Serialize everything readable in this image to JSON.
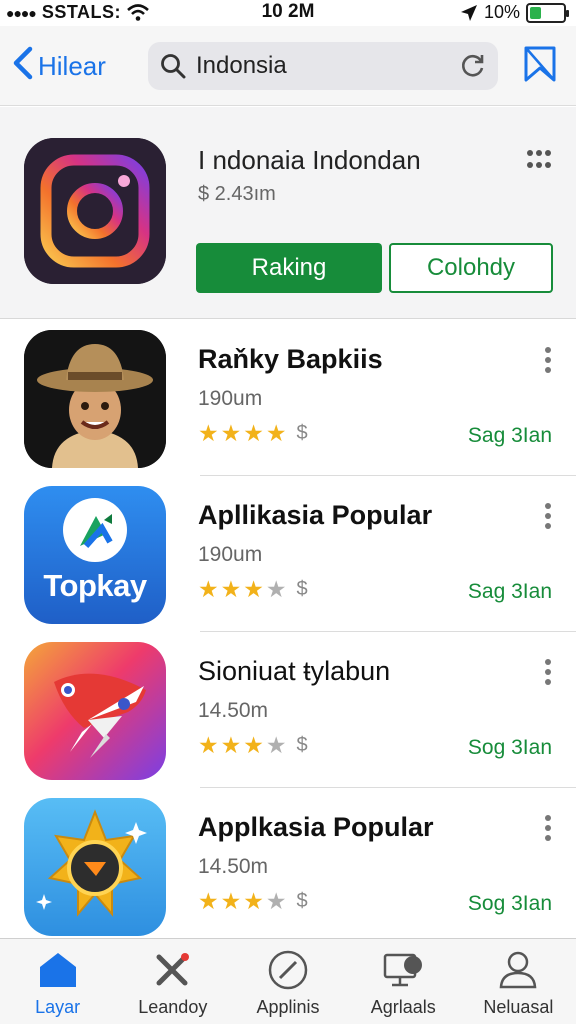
{
  "status_bar": {
    "carrier": "SSTALS:",
    "time": "10 2M",
    "battery": "10%",
    "battery_level": 0.35
  },
  "nav": {
    "back_label": "Hilear",
    "search_value": "Indonsia"
  },
  "featured": {
    "title": "I ndonaia Indondan",
    "price": "$ 2.43ım",
    "primary_button": "Raking",
    "secondary_button": "Colohdy"
  },
  "apps": [
    {
      "name": "Raňky Bapkiis",
      "size": "190um",
      "rating": 4,
      "action": "Sag 3Ian"
    },
    {
      "name": "Apllikasia Popular",
      "size": "190um",
      "rating": 3,
      "icon_text": "Topkay",
      "action": "Sag 3Ian"
    },
    {
      "name": "Sioniuat ŧylabun",
      "size": "14.50m",
      "rating": 3,
      "action": "Sog 3Ian"
    },
    {
      "name": "Applkasia Popular",
      "size": "14.50m",
      "rating": 3,
      "action": "Sog 3Ian"
    }
  ],
  "tabs": [
    {
      "label": "Layar",
      "icon": "home-icon",
      "active": true
    },
    {
      "label": "Leandoy",
      "icon": "tools-icon",
      "active": false
    },
    {
      "label": "Applinis",
      "icon": "compass-icon",
      "active": false
    },
    {
      "label": "Agrlaals",
      "icon": "monitor-icon",
      "active": false
    },
    {
      "label": "Neluasal",
      "icon": "profile-icon",
      "active": false
    }
  ],
  "colors": {
    "accent_blue": "#1a73e8",
    "accent_green": "#178c3a",
    "star": "#f2b21a"
  }
}
